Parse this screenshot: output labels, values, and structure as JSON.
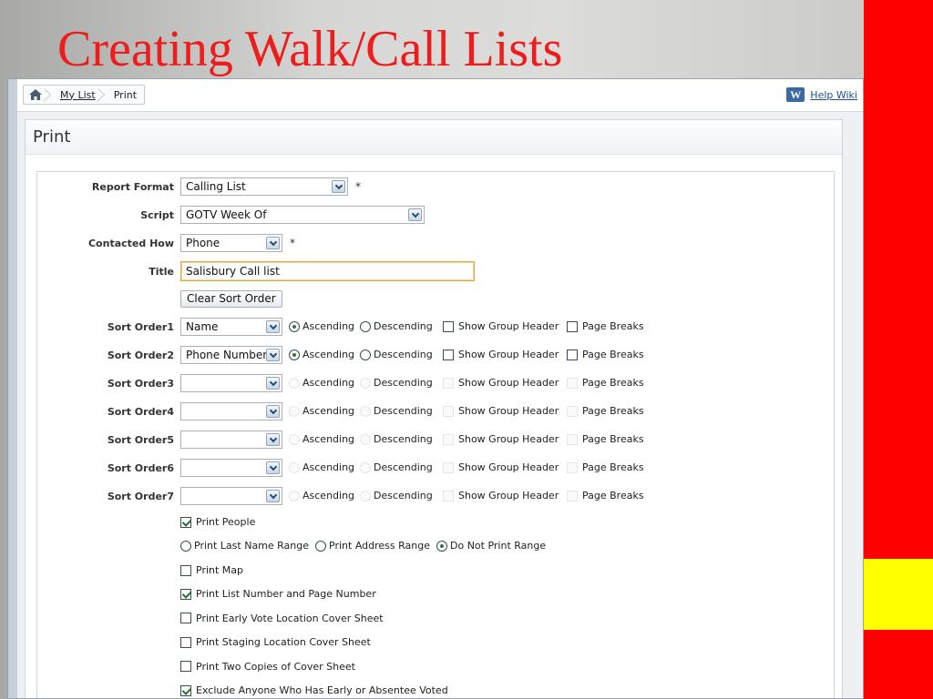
{
  "slide": {
    "title": "Creating Walk/Call Lists"
  },
  "breadcrumb": {
    "home": "home-icon",
    "items": [
      "My List",
      "Print"
    ]
  },
  "help": {
    "icon_letter": "W",
    "label": "Help Wiki"
  },
  "panel": {
    "title": "Print"
  },
  "form": {
    "report_format": {
      "label": "Report Format",
      "value": "Calling List",
      "required": "*"
    },
    "script": {
      "label": "Script",
      "value": "GOTV Week Of"
    },
    "contacted_how": {
      "label": "Contacted How",
      "value": "Phone",
      "required": "*"
    },
    "title": {
      "label": "Title",
      "value": "Salisbury Call list"
    },
    "clear_sort_order": "Clear Sort Order",
    "sort_options": {
      "ascending": "Ascending",
      "descending": "Descending",
      "group_header": "Show Group Header",
      "page_breaks": "Page Breaks"
    },
    "sort_orders": [
      {
        "label": "Sort Order1",
        "value": "Name",
        "ascending": true,
        "enabled": true
      },
      {
        "label": "Sort Order2",
        "value": "Phone Number",
        "ascending": true,
        "enabled": true
      },
      {
        "label": "Sort Order3",
        "value": "",
        "ascending": false,
        "enabled": false
      },
      {
        "label": "Sort Order4",
        "value": "",
        "ascending": false,
        "enabled": false
      },
      {
        "label": "Sort Order5",
        "value": "",
        "ascending": false,
        "enabled": false
      },
      {
        "label": "Sort Order6",
        "value": "",
        "ascending": false,
        "enabled": false
      },
      {
        "label": "Sort Order7",
        "value": "",
        "ascending": false,
        "enabled": false
      }
    ],
    "print_people": {
      "label": "Print People",
      "checked": true
    },
    "range_options": [
      {
        "label": "Print Last Name Range",
        "selected": false
      },
      {
        "label": "Print Address Range",
        "selected": false
      },
      {
        "label": "Do Not Print Range",
        "selected": true
      }
    ],
    "checkboxes": [
      {
        "label": "Print Map",
        "checked": false
      },
      {
        "label": "Print List Number and Page Number",
        "checked": true
      },
      {
        "label": "Print Early Vote Location Cover Sheet",
        "checked": false
      },
      {
        "label": "Print Staging Location Cover Sheet",
        "checked": false
      },
      {
        "label": "Print Two Copies of Cover Sheet",
        "checked": false
      },
      {
        "label": "Exclude Anyone Who Has Early or Absentee Voted",
        "checked": true
      }
    ]
  },
  "colors": {
    "title_red": "#ee1c1c",
    "band_red": "#ff0000",
    "band_yellow": "#ffff00"
  }
}
